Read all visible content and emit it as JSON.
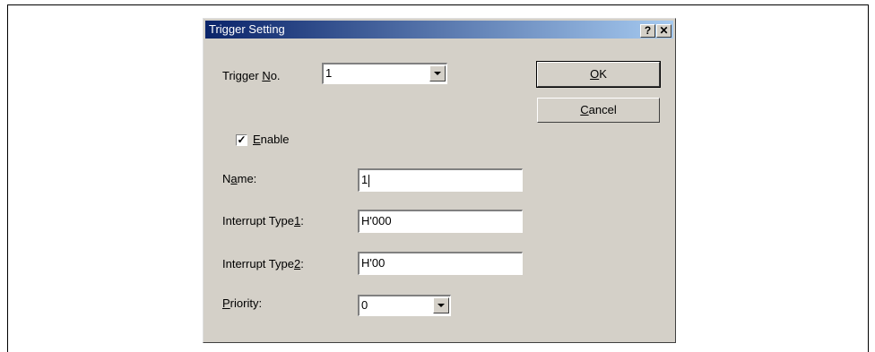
{
  "dialog": {
    "title": "Trigger Setting",
    "help_label": "?",
    "close_label": "✕"
  },
  "trigger_no": {
    "label_before": "Trigger ",
    "label_mnemonic": "N",
    "label_after": "o.",
    "value": "1"
  },
  "enable": {
    "checked": true,
    "label_mnemonic": "E",
    "label_after": "nable"
  },
  "name": {
    "label_before": "N",
    "label_mnemonic": "a",
    "label_after": "me:",
    "value": "1"
  },
  "interrupt_type1": {
    "label_before": "Interrupt Type",
    "label_mnemonic": "1",
    "label_after": ":",
    "value": "H'000"
  },
  "interrupt_type2": {
    "label_before": "Interrupt Type",
    "label_mnemonic": "2",
    "label_after": ":",
    "value": "H'00"
  },
  "priority": {
    "label_mnemonic": "P",
    "label_after": "riority:",
    "value": "0"
  },
  "buttons": {
    "ok_mnemonic": "O",
    "ok_after": "K",
    "cancel_mnemonic": "C",
    "cancel_after": "ancel"
  }
}
